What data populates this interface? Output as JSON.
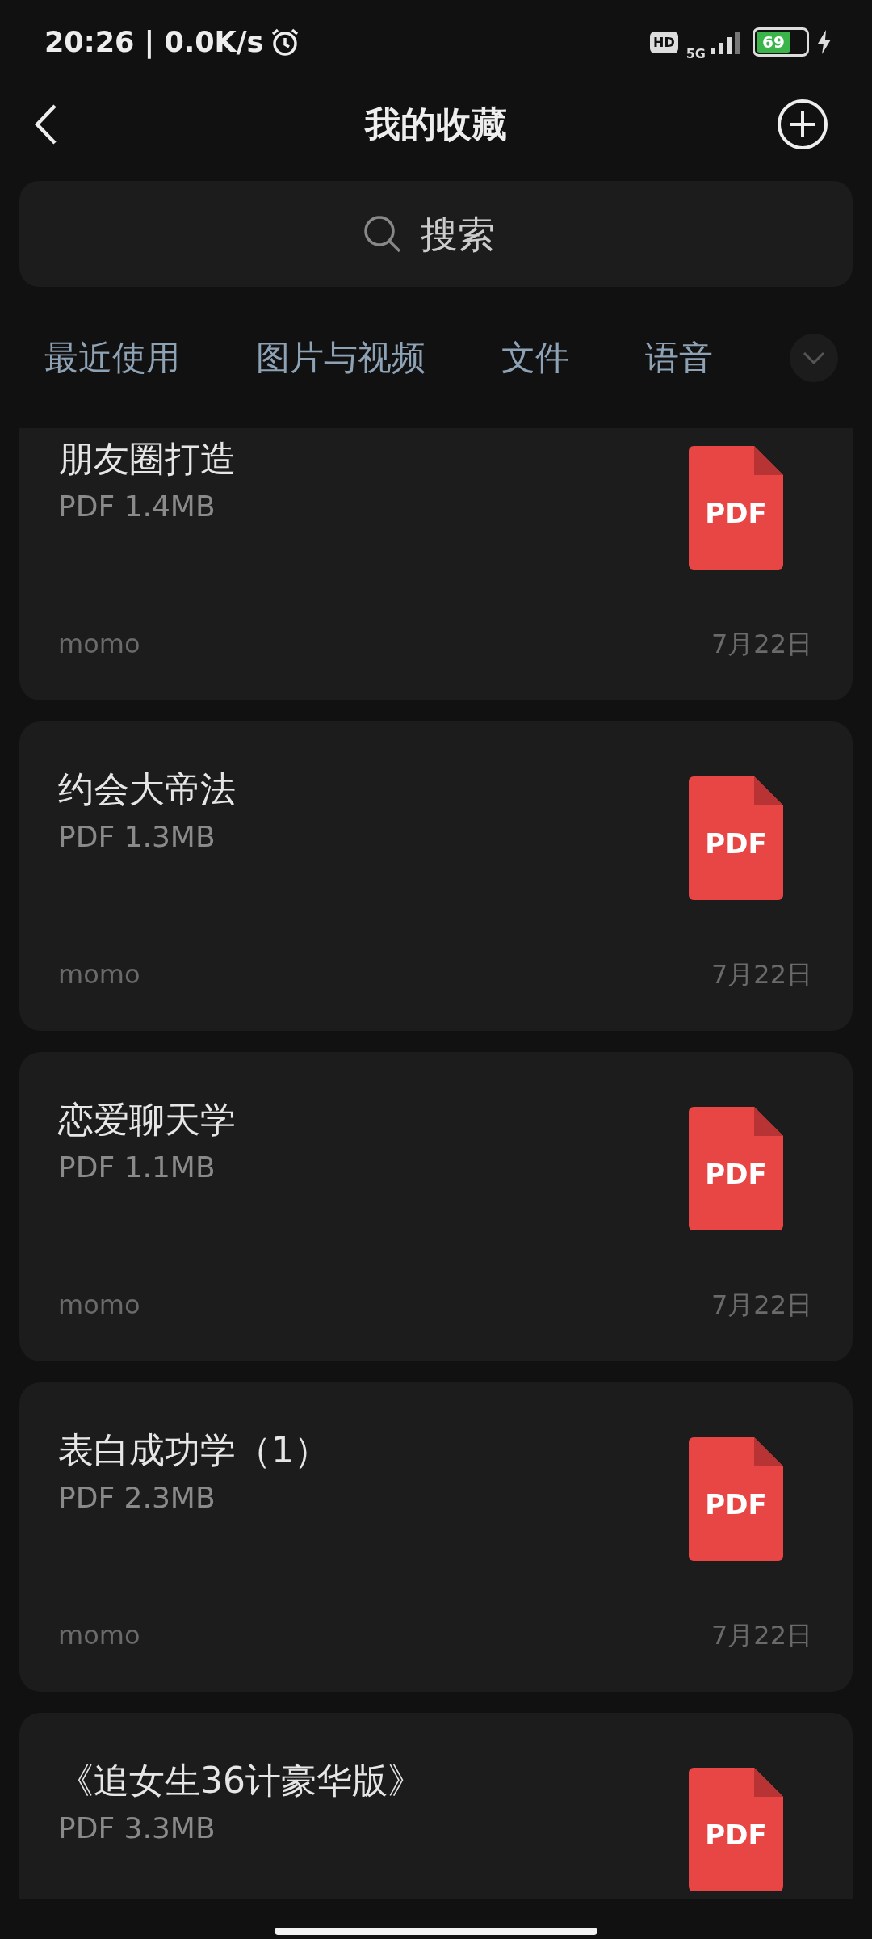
{
  "status_bar": {
    "time": "20:26 | 0.0K/s",
    "hd": "HD",
    "network": "5G",
    "battery": "69"
  },
  "header": {
    "title": "我的收藏"
  },
  "search": {
    "placeholder": "搜索"
  },
  "tabs": [
    {
      "label": "最近使用"
    },
    {
      "label": "图片与视频"
    },
    {
      "label": "文件"
    },
    {
      "label": "语音"
    }
  ],
  "files": [
    {
      "title": "朋友圈打造",
      "size": "PDF 1.4MB",
      "icon_label": "PDF",
      "source": "momo",
      "date": "7月22日"
    },
    {
      "title": "约会大帝法",
      "size": "PDF 1.3MB",
      "icon_label": "PDF",
      "source": "momo",
      "date": "7月22日"
    },
    {
      "title": "恋爱聊天学",
      "size": "PDF 1.1MB",
      "icon_label": "PDF",
      "source": "momo",
      "date": "7月22日"
    },
    {
      "title": "表白成功学（1）",
      "size": "PDF 2.3MB",
      "icon_label": "PDF",
      "source": "momo",
      "date": "7月22日"
    },
    {
      "title": "《追女生36计豪华版》",
      "size": "PDF 3.3MB",
      "icon_label": "PDF"
    }
  ]
}
